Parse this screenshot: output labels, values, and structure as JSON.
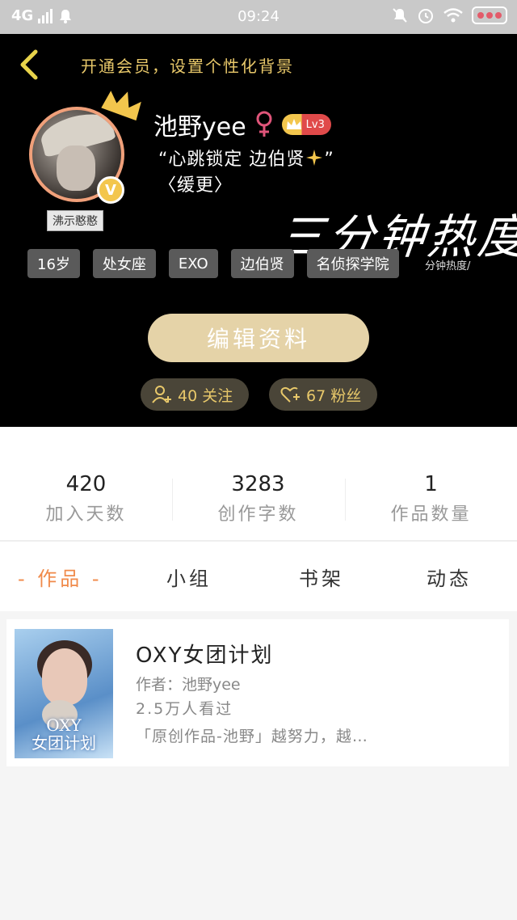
{
  "status_bar": {
    "network": "4G",
    "time": "09:24"
  },
  "header": {
    "vip_hint": "开通会员，设置个性化背景",
    "avatar_caption": "沸示憨憨",
    "username": "池野yee",
    "level": "Lv3",
    "bio_line1": "“心跳锁定 边伯贤",
    "bio_line1_end": "”",
    "bio_line2": "〈缓更〉",
    "signature_art": "三分钟热度",
    "signature_sub": "分钟热度/",
    "tags": [
      "16岁",
      "处女座",
      "EXO",
      "边伯贤",
      "名侦探学院"
    ],
    "edit_button": "编辑资料",
    "following": "40 关注",
    "fans": "67 粉丝"
  },
  "stats": [
    {
      "value": "420",
      "label": "加入天数"
    },
    {
      "value": "3283",
      "label": "创作字数"
    },
    {
      "value": "1",
      "label": "作品数量"
    }
  ],
  "tabs": {
    "works": "- 作品 -",
    "group": "小组",
    "bookshelf": "书架",
    "moments": "动态"
  },
  "works": [
    {
      "cover_text": "OXY\n女团计划",
      "title": "OXY女团计划",
      "author": "作者：池野yee",
      "views": "2.5万人看过",
      "desc": "「原创作品-池野」越努力，越…"
    }
  ],
  "colors": {
    "accent": "#f08a4a",
    "gold": "#e8c86a",
    "edit_button": "#e5d3a8",
    "header_bg": "#000000"
  }
}
